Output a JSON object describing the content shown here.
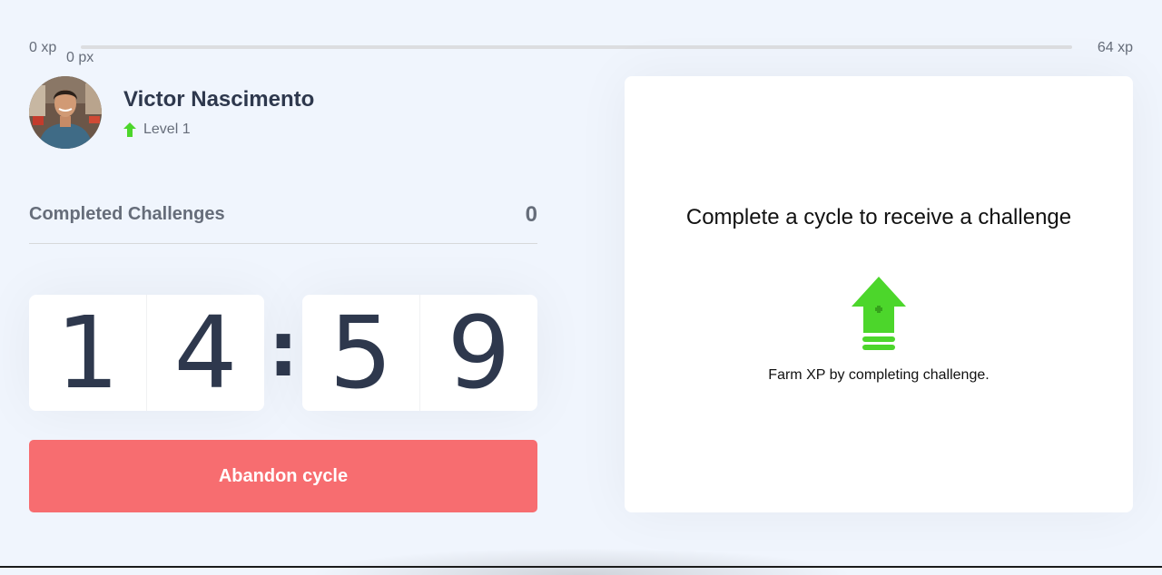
{
  "xp": {
    "min_label": "0 xp",
    "max_label": "64 xp",
    "current_label": "0 px",
    "progress_fraction": 0.0,
    "fill_color": "#4cd62b"
  },
  "profile": {
    "name": "Victor Nascimento",
    "level_label": "Level 1",
    "level_icon": "level-up-arrow-icon",
    "avatar": "avatar-photo"
  },
  "stats": {
    "completed_label": "Completed Challenges",
    "completed_count": "0"
  },
  "countdown": {
    "minute_left": "1",
    "minute_right": "4",
    "separator": ":",
    "second_left": "5",
    "second_right": "9"
  },
  "actions": {
    "abandon_label": "Abandon cycle"
  },
  "challenge": {
    "title": "Complete a cycle to receive a challenge",
    "description": "Farm XP by completing challenge.",
    "icon": "level-up-icon"
  },
  "colors": {
    "background": "#f0f5fd",
    "accent_green": "#4cd62b",
    "danger_red": "#f76d70",
    "text_dark": "#2e384d",
    "text_muted": "#666d7a"
  }
}
